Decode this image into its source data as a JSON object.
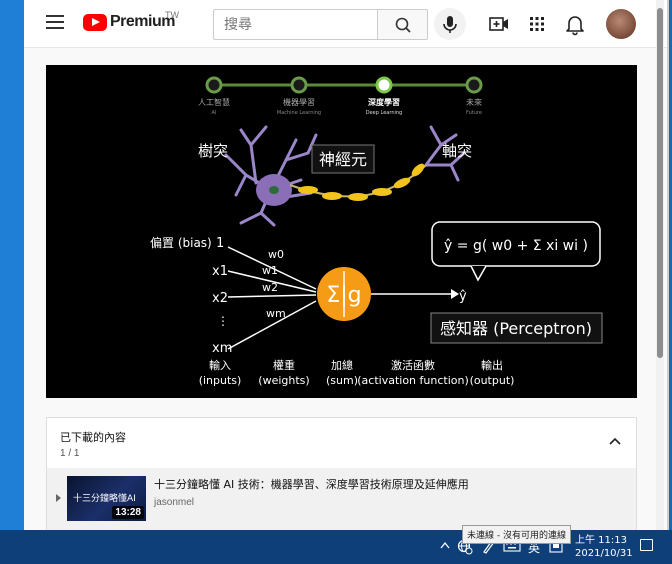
{
  "header": {
    "logo_text": "Premium",
    "logo_country": "TW",
    "search_placeholder": "搜尋"
  },
  "video": {
    "timeline": [
      {
        "label": "人工智慧",
        "sub": "AI"
      },
      {
        "label": "機器學習",
        "sub": "Machine Learning"
      },
      {
        "label": "深度學習",
        "sub": "Deep Learning"
      },
      {
        "label": "未來",
        "sub": "Future"
      }
    ],
    "neuron": {
      "dendrite_label": "樹突",
      "neuron_label": "神經元",
      "axon_label": "軸突"
    },
    "perceptron": {
      "bias_label": "偏置 (bias)",
      "bias_value": "1",
      "inputs": [
        "x1",
        "x2",
        "⋮",
        "xm"
      ],
      "weights": [
        "w0",
        "w1",
        "w2",
        "wm"
      ],
      "node_label": "Σ|g",
      "output_symbol": "ŷ",
      "formula": "ŷ = g( w0 + Σ xi wi )",
      "name": "感知器 (Perceptron)",
      "bottom_labels": [
        {
          "zh": "輸入",
          "en": "(inputs)"
        },
        {
          "zh": "權重",
          "en": "(weights)"
        },
        {
          "zh": "加總",
          "en": "(sum)"
        },
        {
          "zh": "激活函數",
          "en": "(activation function)"
        },
        {
          "zh": "輸出",
          "en": "(output)"
        }
      ]
    }
  },
  "downloads": {
    "title": "已下載的內容",
    "count": "1 / 1",
    "item": {
      "thumb_text": "十三分鐘略懂AI",
      "duration": "13:28",
      "title": "十三分鐘略懂 AI 技術：機器學習、深度學習技術原理及延伸應用",
      "channel": "jasonmel"
    }
  },
  "taskbar": {
    "tooltip": "未連線 - 沒有可用的連線",
    "ime": "英",
    "time": "上午 11:13",
    "date": "2021/10/31"
  }
}
